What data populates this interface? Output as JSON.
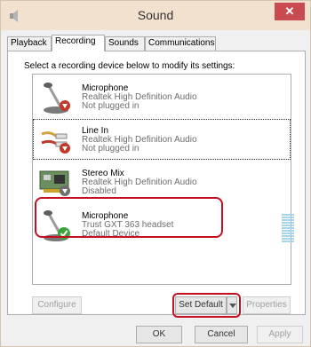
{
  "window": {
    "title": "Sound",
    "close_glyph": "✕"
  },
  "tabs": [
    {
      "label": "Playback"
    },
    {
      "label": "Recording"
    },
    {
      "label": "Sounds"
    },
    {
      "label": "Communications"
    }
  ],
  "instructions": "Select a recording device below to modify its settings:",
  "devices": [
    {
      "name": "Microphone",
      "line1": "Realtek High Definition Audio",
      "line2": "Not plugged in",
      "icon": "microphone-icon",
      "status_icon": "red-down-arrow-icon"
    },
    {
      "name": "Line In",
      "line1": "Realtek High Definition Audio",
      "line2": "Not plugged in",
      "icon": "line-in-icon",
      "status_icon": "red-down-arrow-icon"
    },
    {
      "name": "Stereo Mix",
      "line1": "Realtek High Definition Audio",
      "line2": "Disabled",
      "icon": "sound-card-icon",
      "status_icon": "disabled-arrow-icon"
    },
    {
      "name": "Microphone",
      "line1": "Trust GXT 363 headset",
      "line2": "Default Device",
      "icon": "microphone-icon",
      "status_icon": "green-check-icon"
    }
  ],
  "buttons": {
    "configure": "Configure",
    "set_default": "Set Default",
    "properties": "Properties",
    "ok": "OK",
    "cancel": "Cancel",
    "apply": "Apply"
  },
  "colors": {
    "titlebar": "#f3e1d0",
    "close_button": "#c74b50",
    "highlight": "#c41020",
    "level_meter": "#a8d6e8"
  }
}
